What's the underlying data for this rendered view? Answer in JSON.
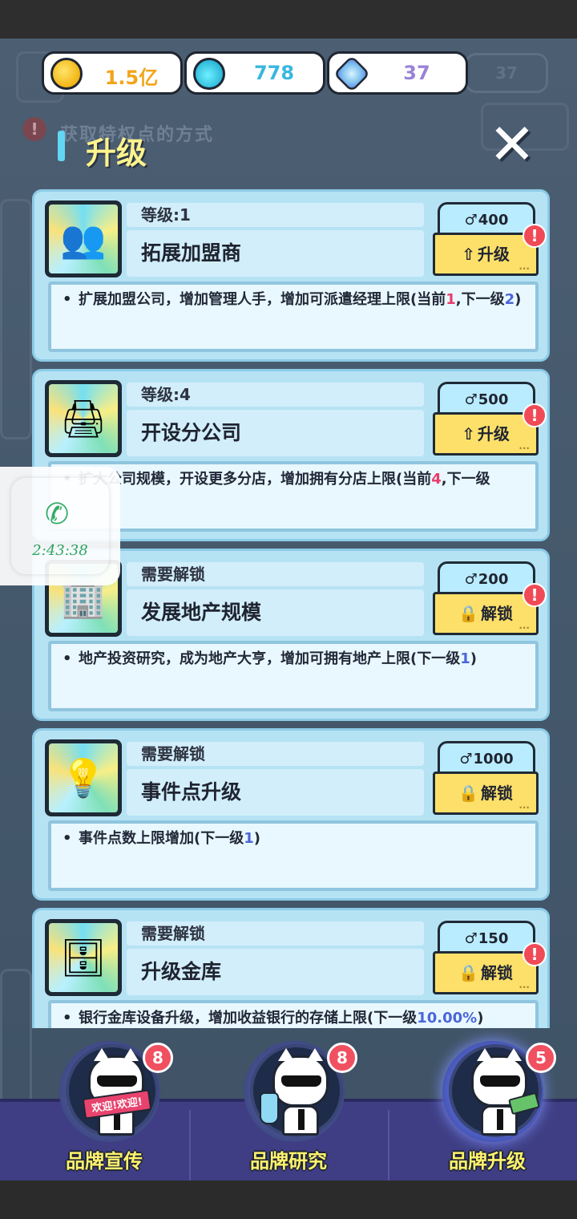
{
  "currencies": [
    {
      "icon": "gold-coin-icon",
      "value": "1.5亿",
      "color": "#f2a51a"
    },
    {
      "icon": "potion-icon",
      "value": "778",
      "color": "#39b7e0"
    },
    {
      "icon": "gem-icon",
      "value": "37",
      "color": "#9a82d8"
    }
  ],
  "background": {
    "ghost_currency_value": "37",
    "hint_text": "获取特权点的方式",
    "hint_badge": "!"
  },
  "header": {
    "title": "升级",
    "close_label": "✕"
  },
  "cards": [
    {
      "level": "等级:1",
      "name": "拓展加盟商",
      "cost": "400",
      "action": "升级",
      "action_icon": "⇧",
      "alert": "!",
      "desc_before": "扩展加盟公司，增加管理人手，增加可派遣经理上限(当前",
      "desc_h1": "1",
      "desc_mid": ",下一级",
      "desc_h2": "2",
      "desc_after": ")"
    },
    {
      "level": "等级:4",
      "name": "开设分公司",
      "cost": "500",
      "action": "升级",
      "action_icon": "⇧",
      "alert": "!",
      "desc_before": "扩大公司规模，开设更多分店，增加拥有分店上限(当前",
      "desc_h1": "4",
      "desc_mid": ",下一级",
      "desc_h2": "",
      "desc_after": ""
    },
    {
      "level": "需要解锁",
      "name": "发展地产规模",
      "cost": "200",
      "action": "解锁",
      "action_icon": "🔒",
      "alert": "!",
      "desc_before": "地产投资研究，成为地产大亨，增加可拥有地产上限(下一级",
      "desc_h1": "",
      "desc_mid": "",
      "desc_h2": "1",
      "desc_after": ")"
    },
    {
      "level": "需要解锁",
      "name": "事件点升级",
      "cost": "1000",
      "action": "解锁",
      "action_icon": "🔒",
      "alert": "",
      "desc_before": "事件点数上限增加(下一级",
      "desc_h1": "",
      "desc_mid": "",
      "desc_h2": "1",
      "desc_after": ")"
    },
    {
      "level": "需要解锁",
      "name": "升级金库",
      "cost": "150",
      "action": "解锁",
      "action_icon": "🔒",
      "alert": "!",
      "desc_before": "银行金库设备升级，增加收益银行的存储上限(下一级",
      "desc_h1": "",
      "desc_mid": "",
      "desc_h2": "10.00%",
      "desc_after": ")"
    }
  ],
  "call_widget": {
    "icon": "phone-icon",
    "time": "2:43:38"
  },
  "nav": [
    {
      "label": "品牌宣传",
      "badge": "8",
      "sign": "欢迎!欢迎!",
      "active": false
    },
    {
      "label": "品牌研究",
      "badge": "8",
      "active": false
    },
    {
      "label": "品牌升级",
      "badge": "5",
      "active": true
    }
  ]
}
